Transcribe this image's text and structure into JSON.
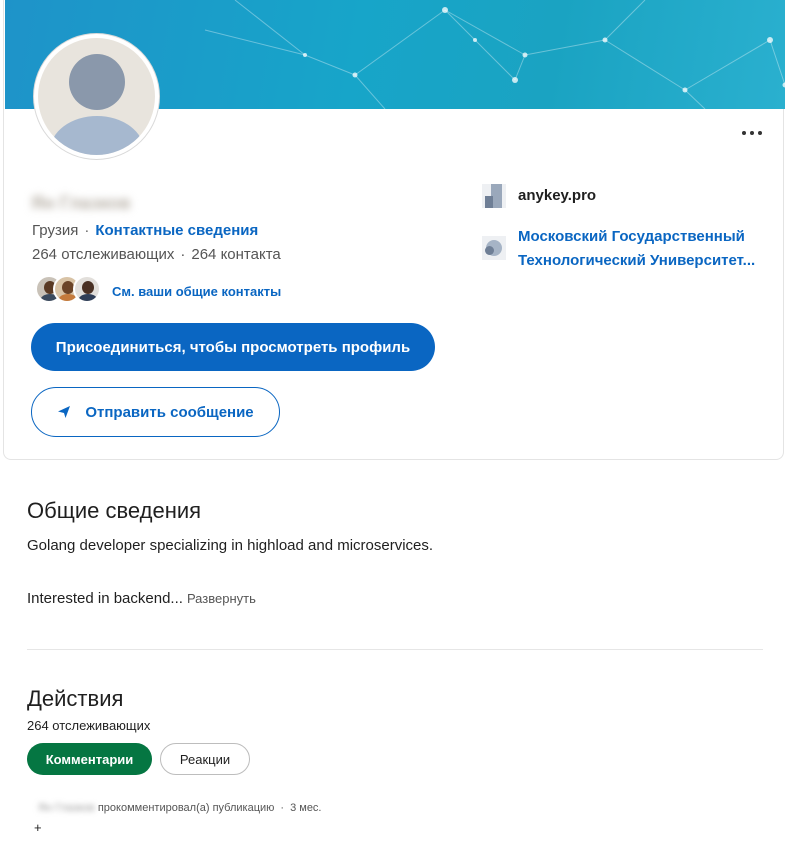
{
  "profile": {
    "name": "Ян Глазков",
    "location": "Грузия",
    "contact_info_link": "Контактные сведения",
    "followers": "264 отслеживающих",
    "connections": "264 контакта",
    "shared_connections_link": "См. ваши общие контакты",
    "join_button": "Присоединиться, чтобы просмотреть профиль",
    "message_button": "Отправить сообщение",
    "company": "anykey.pro",
    "education": "Московский Государственный Технологический Университет..."
  },
  "about": {
    "title": "Общие сведения",
    "line1": "Golang developer specializing in highload and microservices.",
    "line2": "Interested in backend...",
    "expand": "Развернуть"
  },
  "activity": {
    "title": "Действия",
    "followers": "264 отслеживающих",
    "tabs": [
      "Комментарии",
      "Реакции"
    ],
    "item": {
      "actor": "Ян Глазков",
      "action": "прокомментировал(а) публикацию",
      "time": "3 мес."
    },
    "plus": "+"
  },
  "colors": {
    "brand_blue": "#0a66c2",
    "active_tab_green": "#057642",
    "banner": "#1aa3c8"
  },
  "icons": [
    "more-icon",
    "send-icon",
    "company-logo-icon",
    "university-logo-icon"
  ]
}
